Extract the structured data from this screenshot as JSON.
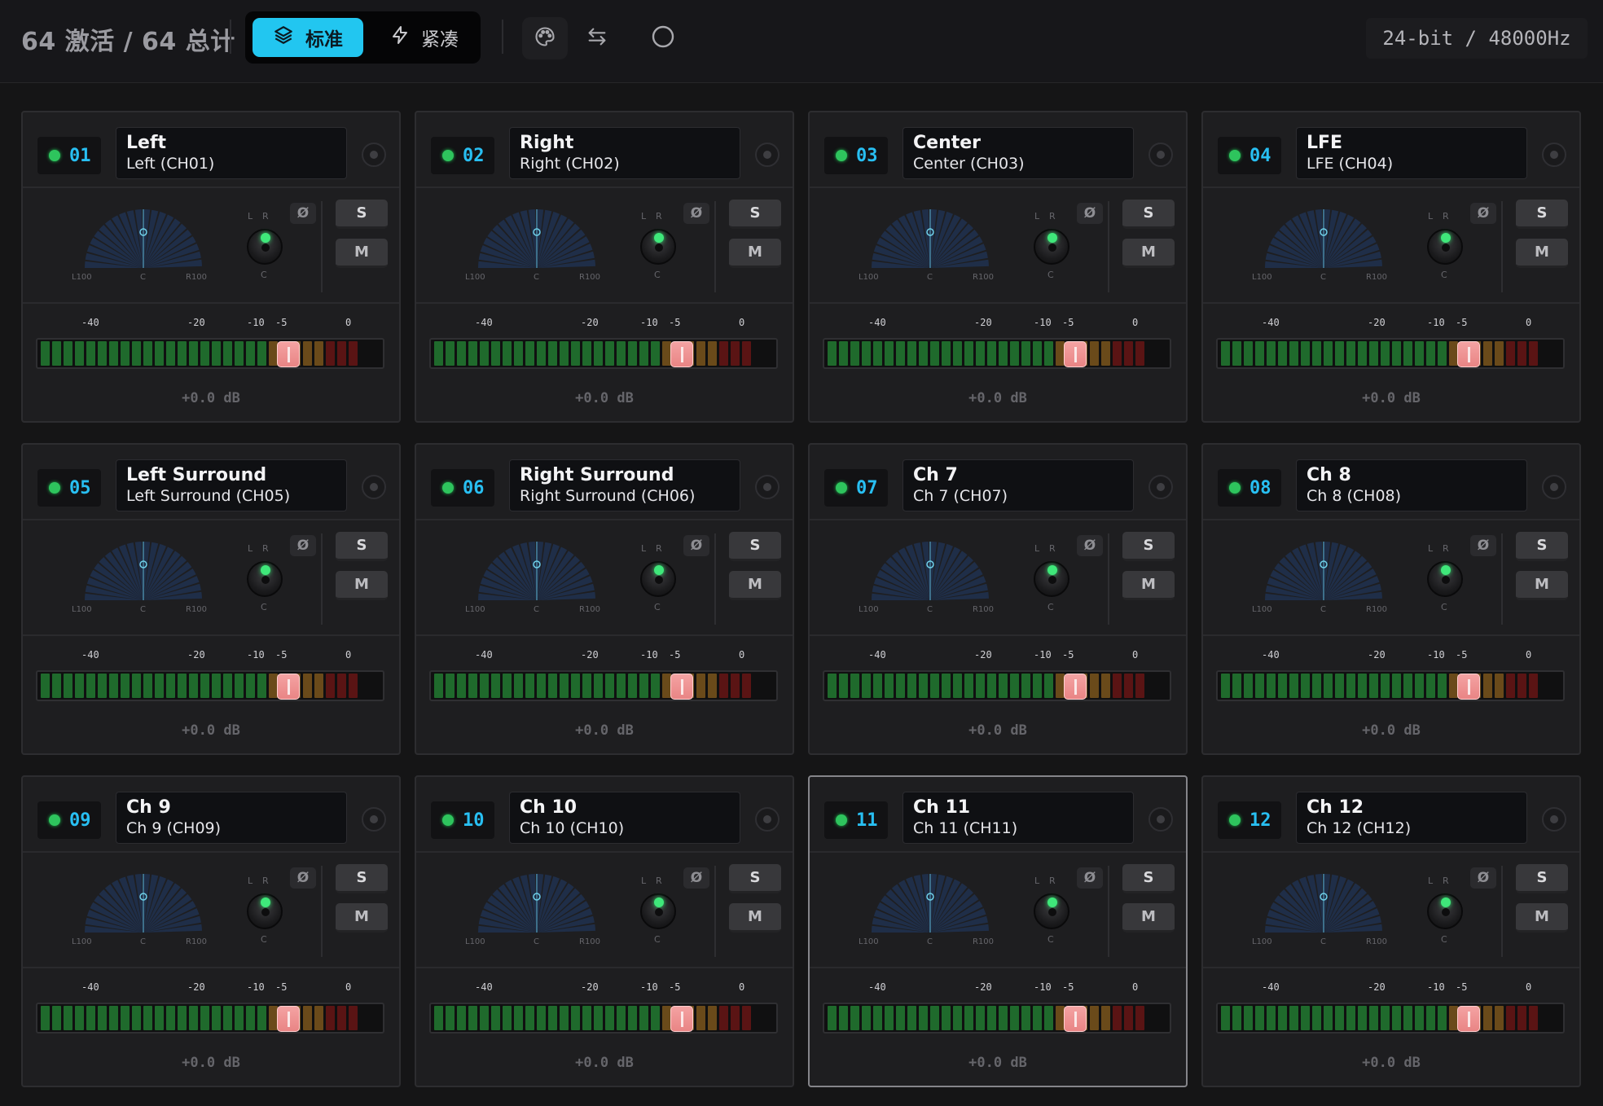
{
  "header": {
    "channel_count": "64 激活 / 64 总计",
    "modes": [
      {
        "label": "标准",
        "icon": "layers-icon",
        "active": true
      },
      {
        "label": "紧凑",
        "icon": "lightning-icon",
        "active": false
      }
    ],
    "tools": [
      {
        "icon": "palette-icon"
      },
      {
        "icon": "swap-icon"
      },
      {
        "icon": "circle-icon"
      }
    ],
    "format": "24-bit / 48000Hz"
  },
  "colors": {
    "accent": "#22c6f0",
    "led_on": "#2ec45d",
    "meter_green": "#1f6a2c",
    "meter_amber": "#6a4a1a",
    "meter_red": "#5a1414",
    "fader": "#e98585"
  },
  "strip_labels": {
    "pan_left": "L100",
    "pan_center": "C",
    "pan_right": "R100",
    "knob_left": "L",
    "knob_right": "R",
    "knob_center": "C",
    "phase": "Ø",
    "solo": "S",
    "mute": "M",
    "scale": [
      "-40",
      "-20",
      "-10",
      "-5",
      "0"
    ]
  },
  "channels": [
    {
      "num": "01",
      "name": "Left",
      "sub": "Left (CH01)",
      "gain": "+0.0 dB",
      "pan": 0.0,
      "fader_db": 0.0
    },
    {
      "num": "02",
      "name": "Right",
      "sub": "Right (CH02)",
      "gain": "+0.0 dB",
      "pan": 0.0,
      "fader_db": 0.0
    },
    {
      "num": "03",
      "name": "Center",
      "sub": "Center (CH03)",
      "gain": "+0.0 dB",
      "pan": 0.0,
      "fader_db": 0.0
    },
    {
      "num": "04",
      "name": "LFE",
      "sub": "LFE (CH04)",
      "gain": "+0.0 dB",
      "pan": 0.0,
      "fader_db": 0.0
    },
    {
      "num": "05",
      "name": "Left Surround",
      "sub": "Left Surround (CH05)",
      "gain": "+0.0 dB",
      "pan": 0.0,
      "fader_db": 0.0
    },
    {
      "num": "06",
      "name": "Right Surround",
      "sub": "Right Surround (CH06)",
      "gain": "+0.0 dB",
      "pan": 0.0,
      "fader_db": 0.0
    },
    {
      "num": "07",
      "name": "Ch 7",
      "sub": "Ch 7 (CH07)",
      "gain": "+0.0 dB",
      "pan": 0.0,
      "fader_db": 0.0
    },
    {
      "num": "08",
      "name": "Ch 8",
      "sub": "Ch 8 (CH08)",
      "gain": "+0.0 dB",
      "pan": 0.0,
      "fader_db": 0.0
    },
    {
      "num": "09",
      "name": "Ch 9",
      "sub": "Ch 9 (CH09)",
      "gain": "+0.0 dB",
      "pan": 0.0,
      "fader_db": 0.0
    },
    {
      "num": "10",
      "name": "Ch 10",
      "sub": "Ch 10 (CH10)",
      "gain": "+0.0 dB",
      "pan": 0.0,
      "fader_db": 0.0
    },
    {
      "num": "11",
      "name": "Ch 11",
      "sub": "Ch 11 (CH11)",
      "gain": "+0.0 dB",
      "pan": 0.0,
      "fader_db": 0.0,
      "selected": true
    },
    {
      "num": "12",
      "name": "Ch 12",
      "sub": "Ch 12 (CH12)",
      "gain": "+0.0 dB",
      "pan": 0.0,
      "fader_db": 0.0
    }
  ]
}
